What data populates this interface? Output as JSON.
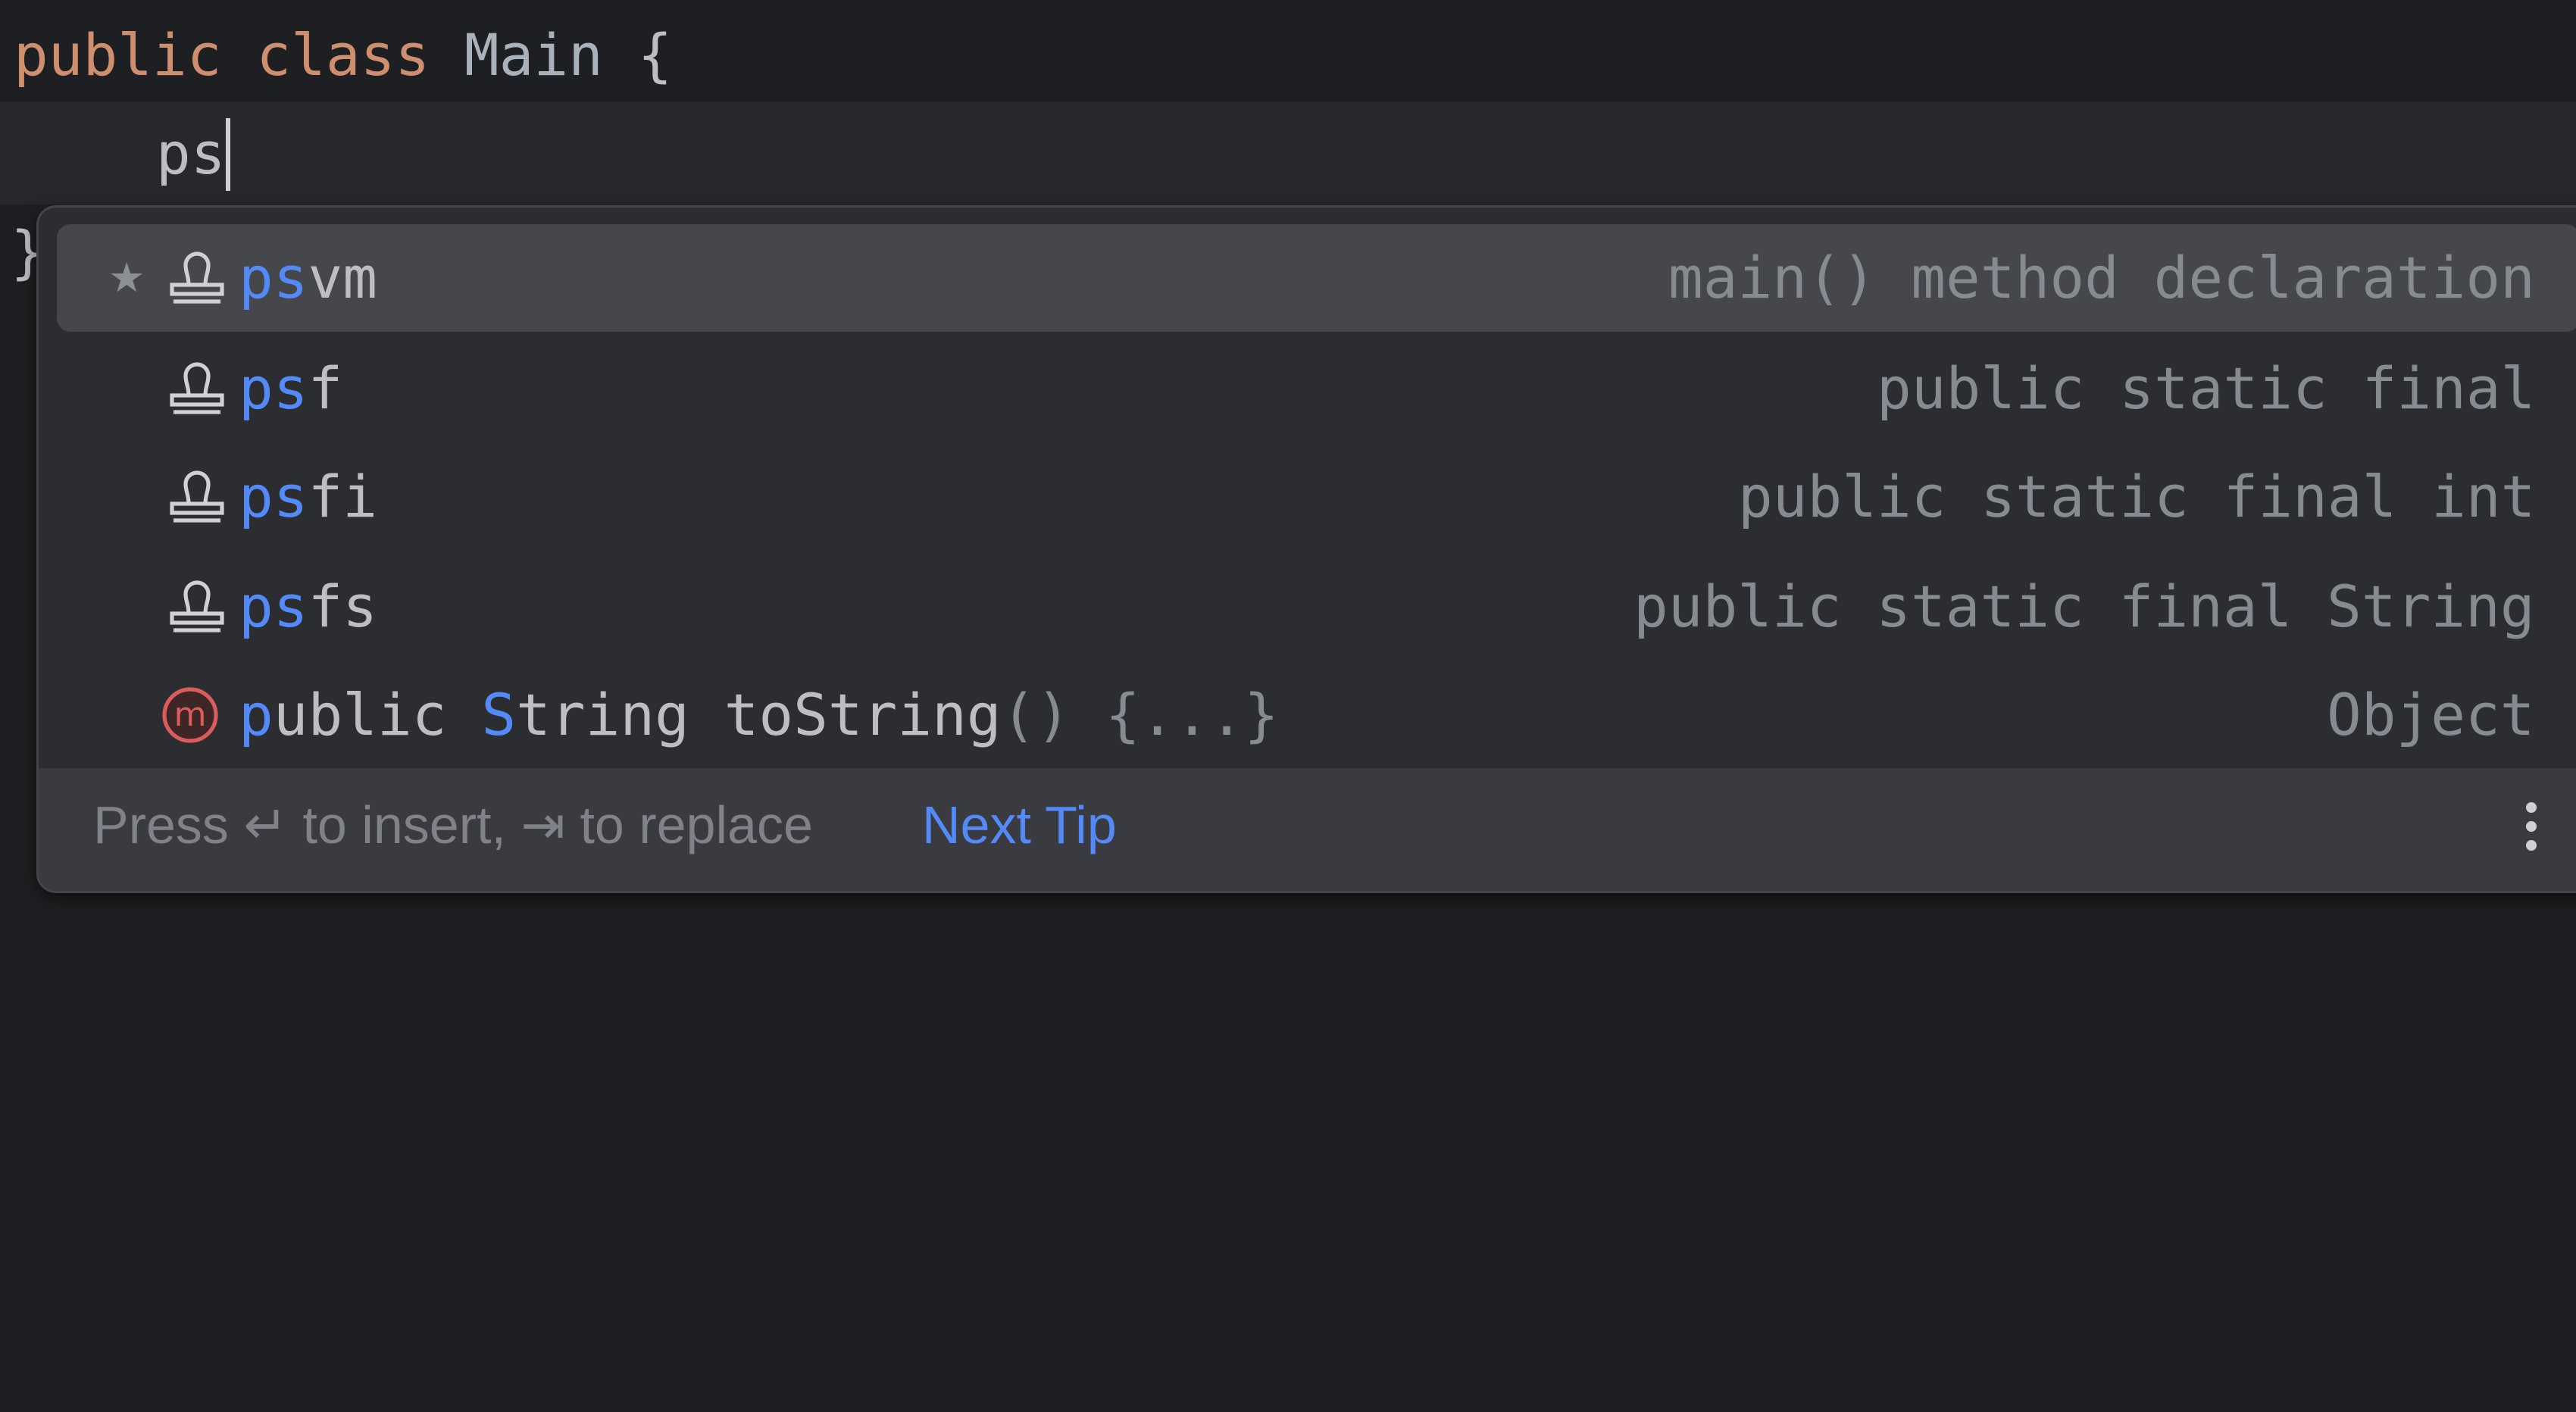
{
  "editor": {
    "line1": {
      "kw1": "public",
      "kw2": "class",
      "name": "Main",
      "brace": "{"
    },
    "line2": {
      "typed": "ps"
    },
    "line3": {
      "brace": "}"
    }
  },
  "popup": {
    "items": [
      {
        "match": "ps",
        "rest": "vm",
        "desc": "main() method declaration",
        "icon": "live-template-stamp-icon",
        "starred": true,
        "selected": true
      },
      {
        "match": "ps",
        "rest": "f",
        "desc": "public static final",
        "icon": "live-template-stamp-icon"
      },
      {
        "match": "ps",
        "rest": "fi",
        "desc": "public static final int",
        "icon": "live-template-stamp-icon"
      },
      {
        "match": "ps",
        "rest": "fs",
        "desc": "public static final String",
        "icon": "live-template-stamp-icon"
      },
      {
        "parts": [
          "p",
          "ublic ",
          "S",
          "tring toString",
          "() {...}"
        ],
        "desc": "Object",
        "icon": "method-icon"
      }
    ],
    "footer": {
      "hint": "Press ↵ to insert, ⇥ to replace",
      "link": "Next Tip"
    }
  },
  "colors": {
    "background": "#1e1f22",
    "popup": "#2b2d30",
    "selected": "#45474b",
    "keyword": "#cf8e6d",
    "match": "#548af7",
    "method_icon": "#db5c5c"
  }
}
